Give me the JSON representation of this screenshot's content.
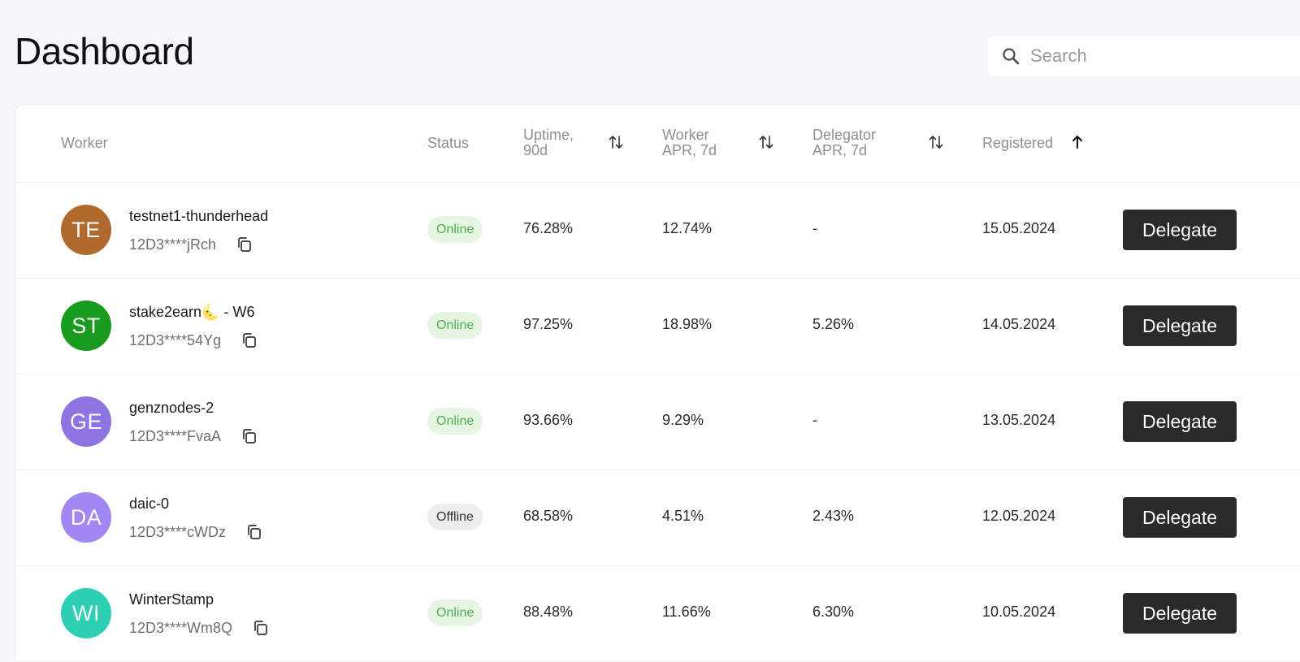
{
  "page": {
    "title": "Dashboard"
  },
  "search": {
    "placeholder": "Search",
    "value": ""
  },
  "table": {
    "columns": {
      "worker": "Worker",
      "status": "Status",
      "uptime": "Uptime, 90d",
      "worker_apr": "Worker APR, 7d",
      "delegator_apr": "Delegator APR, 7d",
      "registered": "Registered"
    },
    "sort": {
      "active_column": "registered",
      "direction": "ascending"
    },
    "rows": [
      {
        "initials": "TE",
        "avatar_color": "#b06a2e",
        "name": "testnet1-thunderhead",
        "peer_id": "12D3****jRch",
        "status": "Online",
        "uptime": "76.28%",
        "worker_apr": "12.74%",
        "delegator_apr": "-",
        "registered": "15.05.2024",
        "action": "Delegate"
      },
      {
        "initials": "ST",
        "avatar_color": "#189b1e",
        "name": "stake2earn🌜 - W6",
        "peer_id": "12D3****54Yg",
        "status": "Online",
        "uptime": "97.25%",
        "worker_apr": "18.98%",
        "delegator_apr": "5.26%",
        "registered": "14.05.2024",
        "action": "Delegate"
      },
      {
        "initials": "GE",
        "avatar_color": "#8e74e0",
        "name": "genznodes-2",
        "peer_id": "12D3****FvaA",
        "status": "Online",
        "uptime": "93.66%",
        "worker_apr": "9.29%",
        "delegator_apr": "-",
        "registered": "13.05.2024",
        "action": "Delegate"
      },
      {
        "initials": "DA",
        "avatar_color": "#a187f2",
        "name": "daic-0",
        "peer_id": "12D3****cWDz",
        "status": "Offline",
        "uptime": "68.58%",
        "worker_apr": "4.51%",
        "delegator_apr": "2.43%",
        "registered": "12.05.2024",
        "action": "Delegate"
      },
      {
        "initials": "WI",
        "avatar_color": "#2ecfb5",
        "name": "WinterStamp",
        "peer_id": "12D3****Wm8Q",
        "status": "Online",
        "uptime": "88.48%",
        "worker_apr": "11.66%",
        "delegator_apr": "6.30%",
        "registered": "10.05.2024",
        "action": "Delegate"
      }
    ]
  },
  "colors": {
    "online_bg": "#e6f6e3",
    "online_text": "#4caf50",
    "offline_bg": "#ededed",
    "offline_text": "#333333",
    "button_bg": "#2a2a2a"
  },
  "icons": {
    "search": "search-icon",
    "copy": "copy-icon",
    "sort_both": "sort-arrows-icon",
    "sort_up": "arrow-up-icon"
  }
}
